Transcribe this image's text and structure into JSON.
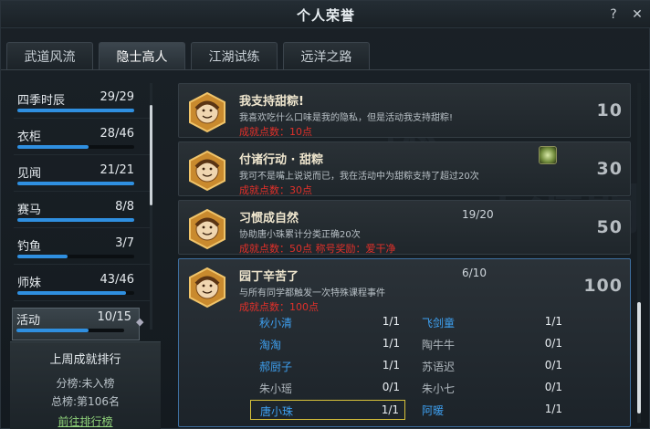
{
  "window": {
    "title": "个人荣誉",
    "help_label": "?",
    "close_label": "✕"
  },
  "tabs": [
    {
      "label": "武道风流",
      "active": false
    },
    {
      "label": "隐士高人",
      "active": true
    },
    {
      "label": "江湖试练",
      "active": false
    },
    {
      "label": "远洋之路",
      "active": false
    }
  ],
  "categories": [
    {
      "label": "四季时辰",
      "count": "29/29",
      "fill": 1.0
    },
    {
      "label": "衣柜",
      "count": "28/46",
      "fill": 0.61
    },
    {
      "label": "见闻",
      "count": "21/21",
      "fill": 1.0
    },
    {
      "label": "赛马",
      "count": "8/8",
      "fill": 1.0
    },
    {
      "label": "钓鱼",
      "count": "3/7",
      "fill": 0.43
    },
    {
      "label": "师妹",
      "count": "43/46",
      "fill": 0.93
    },
    {
      "label": "活动",
      "count": "10/15",
      "fill": 0.67,
      "selected": true
    }
  ],
  "ranking": {
    "title": "上周成就排行",
    "line1": "分榜:未入榜",
    "line2": "总榜:第106名",
    "link": "前往排行榜"
  },
  "achievements": [
    {
      "title": "我支持甜粽!",
      "desc": "我喜欢吃什么口味是我的隐私，但是活动我支持甜粽!",
      "points": "成就点数：10点",
      "score": "10"
    },
    {
      "title": "付诸行动 · 甜粽",
      "desc": "我可不是嘴上说说而已，我在活动中为甜粽支持了超过20次",
      "points": "成就点数：30点",
      "score": "30"
    },
    {
      "title": "习惯成自然",
      "progress": "19/20",
      "desc": "协助唐小珠累计分类正确20次",
      "points": "成就点数：50点",
      "reward": "称号奖励：爱干净",
      "score": "50"
    },
    {
      "title": "园丁辛苦了",
      "progress": "6/10",
      "desc": "与所有同学都触发一次特殊课程事件",
      "points": "成就点数：100点",
      "score": "100"
    }
  ],
  "students": [
    {
      "name": "秋小清",
      "value": "1/1",
      "done": true
    },
    {
      "name": "飞剑童",
      "value": "1/1",
      "done": true
    },
    {
      "name": "淘淘",
      "value": "1/1",
      "done": true
    },
    {
      "name": "陶牛牛",
      "value": "0/1",
      "done": false
    },
    {
      "name": "郝厨子",
      "value": "1/1",
      "done": true
    },
    {
      "name": "苏语迟",
      "value": "0/1",
      "done": false
    },
    {
      "name": "朱小瑶",
      "value": "0/1",
      "done": false
    },
    {
      "name": "朱小七",
      "value": "0/1",
      "done": false
    },
    {
      "name": "唐小珠",
      "value": "1/1",
      "done": true,
      "highlight": true
    },
    {
      "name": "阿暖",
      "value": "1/1",
      "done": true
    }
  ],
  "colors": {
    "accent": "#2f8fe0",
    "points": "#e0302a",
    "done_name": "#3ea0f0",
    "link": "#8fd27a",
    "highlight": "#d8c23a"
  }
}
